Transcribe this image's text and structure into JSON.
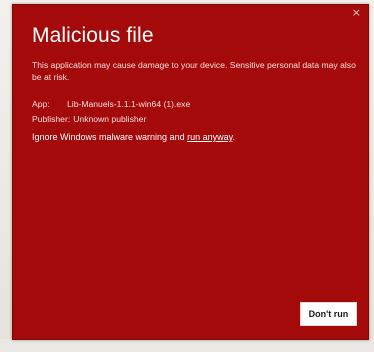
{
  "dialog": {
    "title": "Malicious file",
    "close_glyph": "×",
    "message": "This application may cause damage to your device. Sensitive personal data may also be at risk.",
    "app_label": "App:",
    "app_value": "Lib-Manuels-1.1.1-win64 (1).exe",
    "publisher_label": "Publisher:",
    "publisher_value": "Unknown publisher",
    "ignore_text": "Ignore Windows malware warning and ",
    "run_anyway_label": "run anyway",
    "run_anyway_suffix": ".",
    "dont_run_label": "Don't run",
    "background_color": "#a50a0a"
  },
  "icons": {
    "close": "close-icon"
  }
}
